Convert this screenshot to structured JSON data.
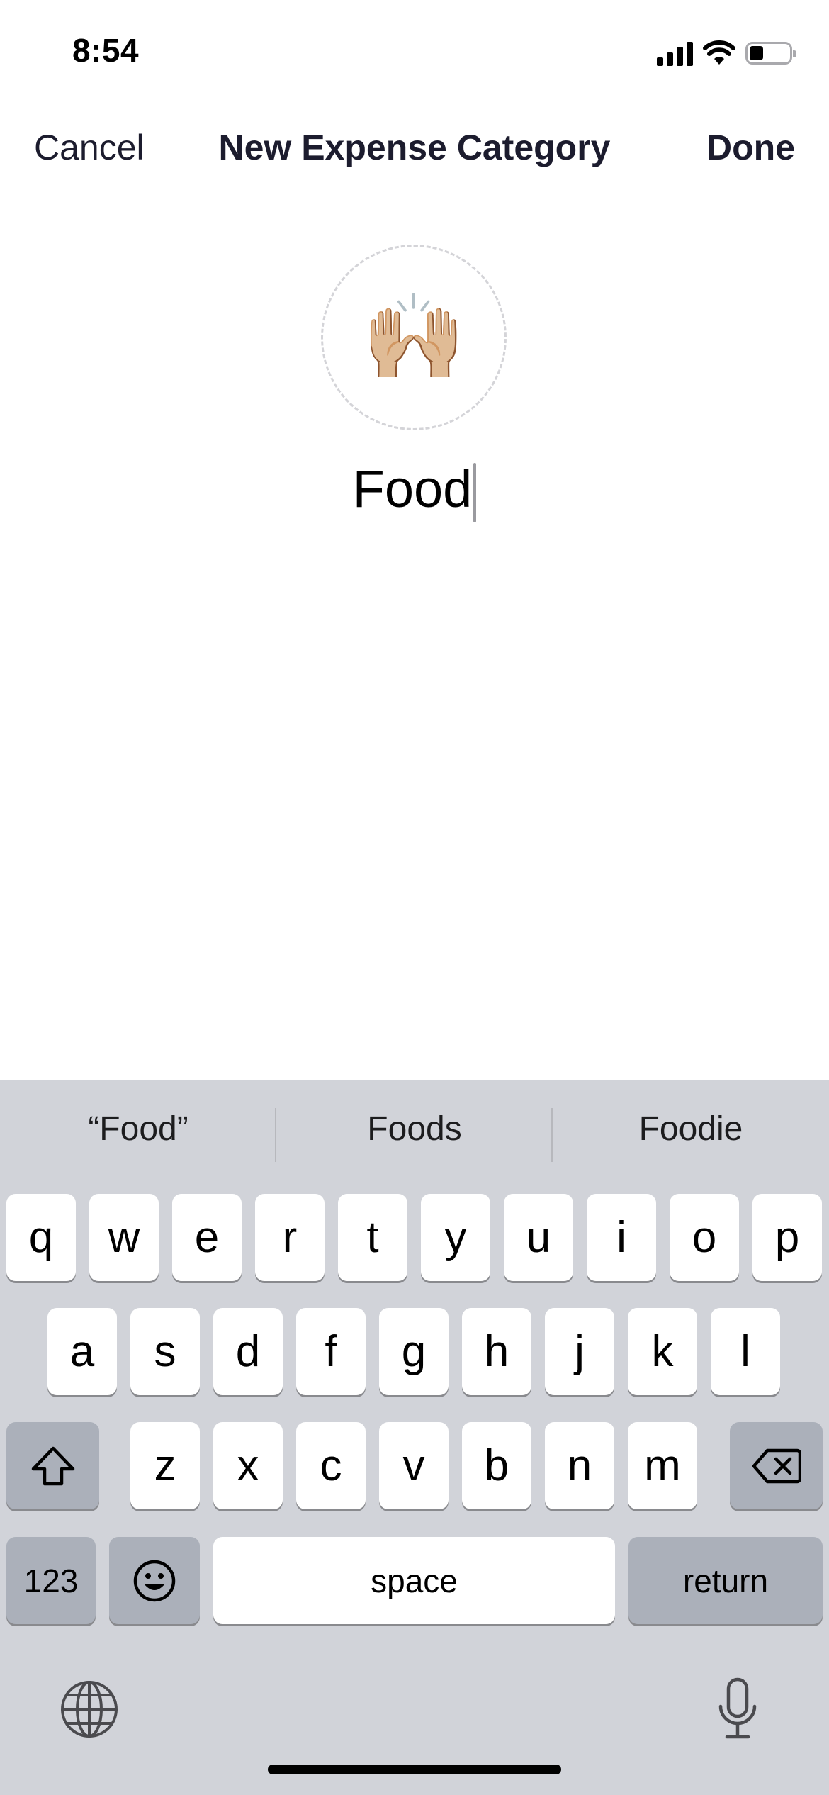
{
  "status": {
    "time": "8:54",
    "battery_level": 0.35
  },
  "nav": {
    "cancel": "Cancel",
    "title": "New Expense Category",
    "done": "Done"
  },
  "category": {
    "emoji": "🙌🏼",
    "name": "Food"
  },
  "keyboard": {
    "suggestions": [
      "“Food”",
      "Foods",
      "Foodie"
    ],
    "row1": [
      "q",
      "w",
      "e",
      "r",
      "t",
      "y",
      "u",
      "i",
      "o",
      "p"
    ],
    "row2": [
      "a",
      "s",
      "d",
      "f",
      "g",
      "h",
      "j",
      "k",
      "l"
    ],
    "row3": [
      "z",
      "x",
      "c",
      "v",
      "b",
      "n",
      "m"
    ],
    "numbers_key": "123",
    "space_key": "space",
    "return_key": "return"
  },
  "colors": {
    "keyboard_bg": "#d1d3d9",
    "dark_key": "#abb0ba",
    "text": "#1c1c2e"
  }
}
